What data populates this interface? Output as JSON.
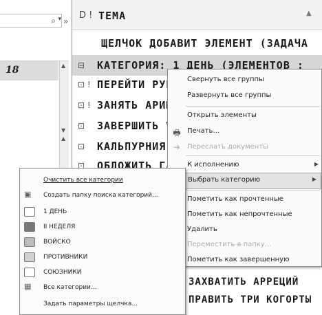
{
  "header": {
    "theme_label": "ТЕМА",
    "icons": "D ! "
  },
  "calendar": {
    "day_number": "18"
  },
  "rows": [
    {
      "icon": "",
      "text": "ЩЕЛЧОК ДОБАВИТ ЭЛЕМЕНТ (ЗАДАЧА"
    },
    {
      "icon": "⊟",
      "text": "КАТЕГОРИЯ: 1 ДЕНЬ (ЭЛЕМЕНТОВ :"
    },
    {
      "icon": "⊡ !",
      "text": "ПЕРЕЙТИ РУБ"
    },
    {
      "icon": "⊡ !",
      "text": "ЗАНЯТЬ АРИМ"
    },
    {
      "icon": "⊡",
      "text": "ЗАВЕРШИТЬ VII"
    },
    {
      "icon": "⊡",
      "text": "КАЛЬПУРНИЯ: П"
    },
    {
      "icon": "⊡",
      "text": "ОБЛОЖИТЬ ГАЛ"
    }
  ],
  "context_menu": {
    "items": [
      {
        "label": "Свернуть все группы",
        "disabled": false
      },
      {
        "label": "Развернуть все группы",
        "disabled": false
      },
      {
        "label": "Открыть элементы",
        "disabled": false
      },
      {
        "label": "Печать...",
        "disabled": false,
        "icon": "printer-icon"
      },
      {
        "label": "Переслать документы",
        "disabled": true,
        "icon": "forward-icon"
      },
      {
        "label": "К исполнению",
        "disabled": false,
        "submenu": true
      },
      {
        "label": "Выбрать категорию",
        "disabled": false,
        "submenu": true
      },
      {
        "label": "Пометить как прочтенные",
        "disabled": false,
        "icon": "read-icon"
      },
      {
        "label": "Пометить как непрочтенные",
        "disabled": false,
        "icon": "unread-icon"
      },
      {
        "label": "Удалить",
        "disabled": false,
        "icon": "delete-icon"
      },
      {
        "label": "Переместить в папку...",
        "disabled": true,
        "icon": "move-icon"
      },
      {
        "label": "Пометить как завершенную",
        "disabled": false,
        "icon": "complete-icon"
      }
    ]
  },
  "category_menu": {
    "items": [
      {
        "label": "Очистить все категории",
        "kind": "action"
      },
      {
        "label": "Создать папку поиска категорий...",
        "kind": "action"
      },
      {
        "label": "1 ДЕНЬ",
        "kind": "category",
        "color": "#ffffff"
      },
      {
        "label": "II НЕДЕЛЯ",
        "kind": "category",
        "color": "#777777"
      },
      {
        "label": "ВОЙСКО",
        "kind": "category",
        "color": "#bdbdbd"
      },
      {
        "label": "ПРОТИВНИКИ",
        "kind": "category",
        "color": "#d0d0d0"
      },
      {
        "label": "СОЮЗНИКИ",
        "kind": "category",
        "color": "#ffffff"
      },
      {
        "label": "Все категории...",
        "kind": "action"
      },
      {
        "label": "Задать параметры щелчка...",
        "kind": "action"
      }
    ]
  },
  "bottom_rows": [
    "ЗАХВАТИТЬ АРРЕЦИЙ",
    "ПРАВИТЬ ТРИ КОГОРТЫ"
  ]
}
